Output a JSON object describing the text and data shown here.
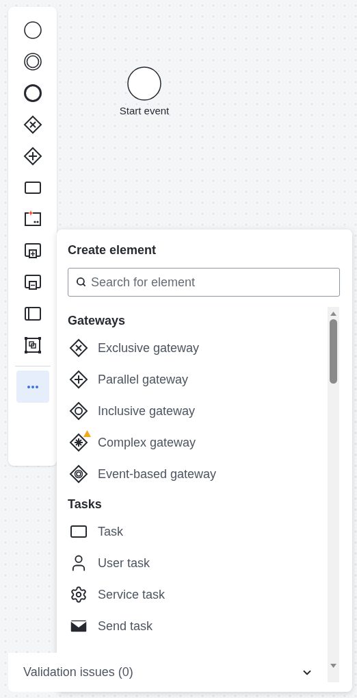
{
  "toolbar": {
    "tools": [
      {
        "kind": "start-event"
      },
      {
        "kind": "intermediate-event"
      },
      {
        "kind": "end-event"
      },
      {
        "kind": "exclusive-gateway"
      },
      {
        "kind": "parallel-gateway"
      },
      {
        "kind": "task"
      },
      {
        "kind": "ai-task"
      },
      {
        "kind": "expanded-subprocess"
      },
      {
        "kind": "collapsed-subprocess"
      },
      {
        "kind": "pool"
      },
      {
        "kind": "group"
      }
    ],
    "more_button": {
      "active": true
    }
  },
  "canvas": {
    "elements": [
      {
        "kind": "start-event",
        "label": "Start event"
      }
    ]
  },
  "popup": {
    "title": "Create element",
    "search": {
      "placeholder": "Search for element"
    },
    "groups": [
      {
        "title": "Gateways",
        "items": [
          {
            "kind": "exclusive-gateway",
            "label": "Exclusive gateway",
            "warning": false
          },
          {
            "kind": "parallel-gateway",
            "label": "Parallel gateway",
            "warning": false
          },
          {
            "kind": "inclusive-gateway",
            "label": "Inclusive gateway",
            "warning": false
          },
          {
            "kind": "complex-gateway",
            "label": "Complex gateway",
            "warning": true
          },
          {
            "kind": "event-gateway",
            "label": "Event-based gateway",
            "warning": false
          }
        ]
      },
      {
        "title": "Tasks",
        "items": [
          {
            "kind": "task",
            "label": "Task",
            "warning": false
          },
          {
            "kind": "user-task",
            "label": "User task",
            "warning": false
          },
          {
            "kind": "service-task",
            "label": "Service task",
            "warning": false
          },
          {
            "kind": "send-task",
            "label": "Send task",
            "warning": false
          }
        ]
      }
    ]
  },
  "validation": {
    "label": "Validation issues (0)",
    "expanded": false
  }
}
